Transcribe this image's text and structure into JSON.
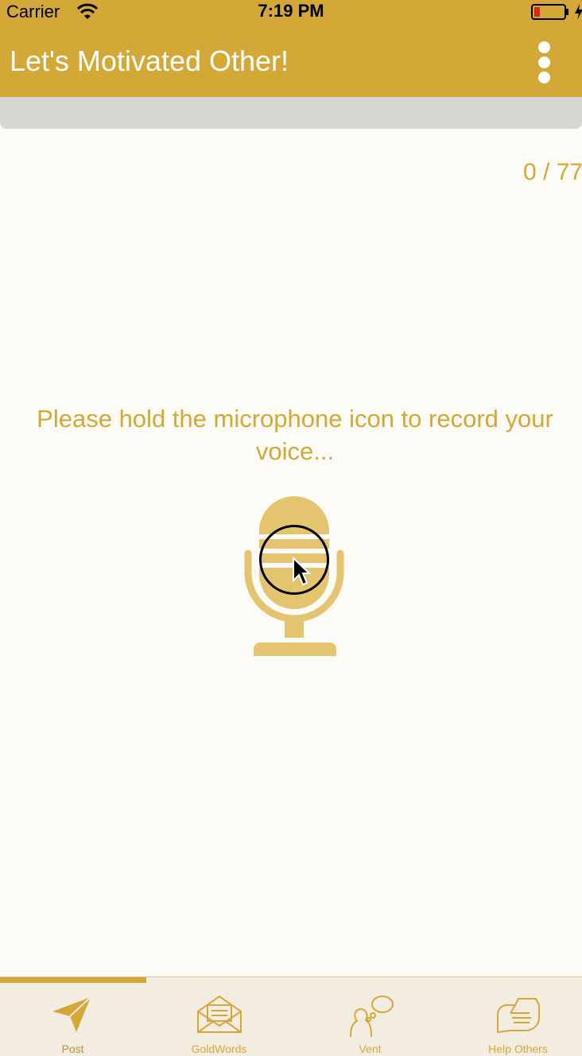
{
  "status_bar": {
    "carrier": "Carrier",
    "time": "7:19 PM"
  },
  "header": {
    "title": "Let's Motivated Other!",
    "menu_icon": "more-vertical-icon"
  },
  "record": {
    "counter": "0 / 77",
    "instruction": "Please hold the microphone icon to record your voice...",
    "mic_icon": "microphone-icon"
  },
  "tabs": [
    {
      "label": "Post",
      "icon": "paper-plane-icon",
      "active": true
    },
    {
      "label": "GoldWords",
      "icon": "envelope-icon",
      "active": false
    },
    {
      "label": "Vent",
      "icon": "speech-bubble-person-icon",
      "active": false
    },
    {
      "label": "Help Others",
      "icon": "handshake-icon",
      "active": false
    }
  ],
  "colors": {
    "accent": "#d4a837",
    "mic": "#e4c46f",
    "background": "#fdfbf6",
    "tab_bar": "#f3ece0"
  }
}
